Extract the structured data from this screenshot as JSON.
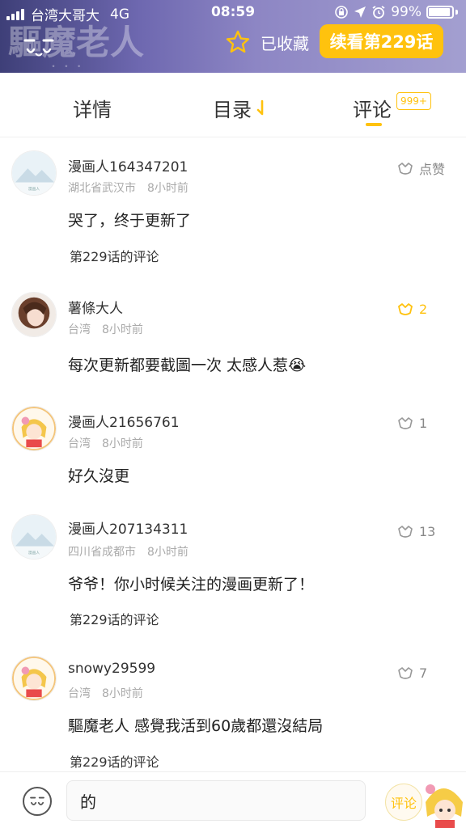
{
  "status_bar": {
    "carrier": "台湾大哥大",
    "network": "4G",
    "time": "08:59",
    "battery": "99%"
  },
  "header": {
    "favorited_label": "已收藏",
    "continue_label": "续看第229话"
  },
  "tabs": [
    {
      "label": "详情"
    },
    {
      "label": "目录"
    },
    {
      "label": "评论",
      "badge": "999+",
      "active": true
    }
  ],
  "comments": [
    {
      "username": "漫画人164347201",
      "location": "湖北省武汉市",
      "time": "8小时前",
      "text": "哭了，终于更新了",
      "chapter": "第229话的评论",
      "likes": "点赞",
      "liked": false,
      "avatar": "default"
    },
    {
      "username": "薯條大人",
      "location": "台湾",
      "time": "8小时前",
      "text": "每次更新都要截圖一次 太感人惹😭",
      "chapter": "",
      "likes": "2",
      "liked": true,
      "avatar": "photo"
    },
    {
      "username": "漫画人21656761",
      "location": "台湾",
      "time": "8小时前",
      "text": "好久沒更",
      "chapter": "",
      "likes": "1",
      "liked": false,
      "avatar": "girl"
    },
    {
      "username": "漫画人207134311",
      "location": "四川省成都市",
      "time": "8小时前",
      "text": "爷爷！你小时候关注的漫画更新了！",
      "chapter": "第229话的评论",
      "likes": "13",
      "liked": false,
      "avatar": "default"
    },
    {
      "username": "snowy29599",
      "location": "台湾",
      "time": "8小时前",
      "text": "驅魔老人 感覺我活到60歲都還沒結局",
      "chapter": "第229话的评论",
      "likes": "7",
      "liked": false,
      "avatar": "girl"
    }
  ],
  "composer": {
    "input_value": "的",
    "send_label": "评论"
  },
  "colors": {
    "accent": "#ffc20e",
    "header_bg": "#6e68b0"
  }
}
